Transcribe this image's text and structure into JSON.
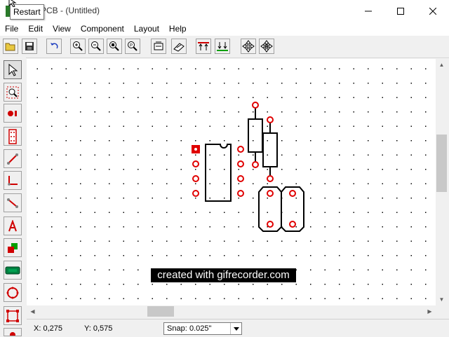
{
  "window": {
    "title": "PCB - (Untitled)",
    "tooltip": "Restart"
  },
  "menu": [
    "File",
    "Edit",
    "View",
    "Component",
    "Layout",
    "Help"
  ],
  "toolbar_icons": [
    "open-folder-icon",
    "save-icon",
    "undo-icon",
    "zoom-in-icon",
    "zoom-out-icon",
    "zoom-fit-icon",
    "zoom-page-icon",
    "properties-icon",
    "print-icon",
    "pad-top-icon",
    "pad-bottom-icon",
    "move-icon",
    "autoroute-icon"
  ],
  "toolbox_icons": [
    "select-arrow-icon",
    "zoom-select-icon",
    "pad-icon",
    "dip-icon",
    "track-icon",
    "corner-icon",
    "line-icon",
    "text-icon",
    "layer-icon",
    "component-icon",
    "circle-icon",
    "area-icon"
  ],
  "colors": {
    "pad": "#e00000",
    "outline": "#000000"
  },
  "watermark": "created with gifrecorder.com",
  "status": {
    "x": "X: 0,275",
    "y": "Y: 0,575",
    "snap_label": "Snap:",
    "snap_value": "0.025\""
  }
}
